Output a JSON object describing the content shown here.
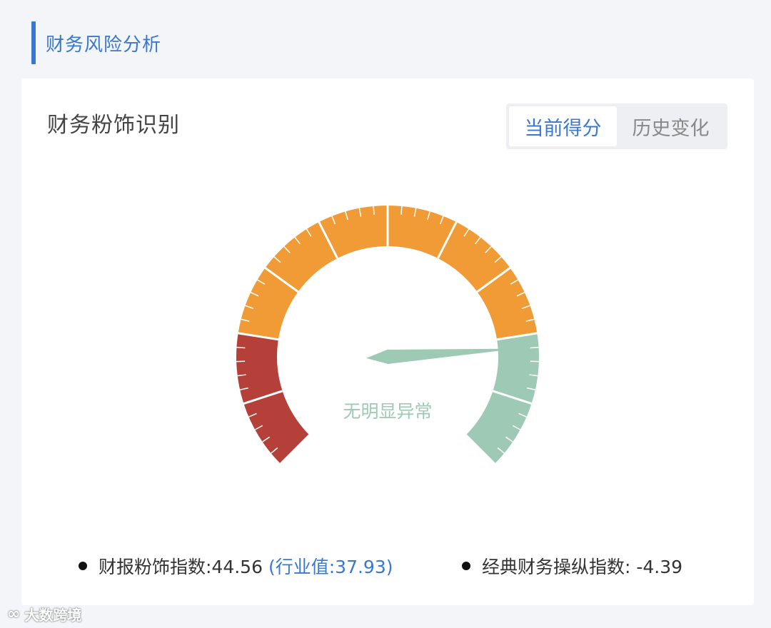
{
  "section": {
    "title": "财务风险分析"
  },
  "card": {
    "title": "财务粉饰识别",
    "tabs": [
      {
        "label": "当前得分",
        "active": true
      },
      {
        "label": "历史变化",
        "active": false
      }
    ]
  },
  "gauge": {
    "status_label": "无明显异常",
    "pointer_value": 0.82,
    "colors": {
      "danger": "#b5403a",
      "warning": "#f09b35",
      "safe": "#9ecab5",
      "status_text": "#9ecab5"
    }
  },
  "metrics": {
    "fraud_index_label": "财报粉饰指数:44.56",
    "fraud_index_industry": "(行业值:37.93)",
    "classic_index_label": "经典财务操纵指数: -4.39"
  },
  "watermark": {
    "text": "大数跨境",
    "logo": "∞"
  }
}
